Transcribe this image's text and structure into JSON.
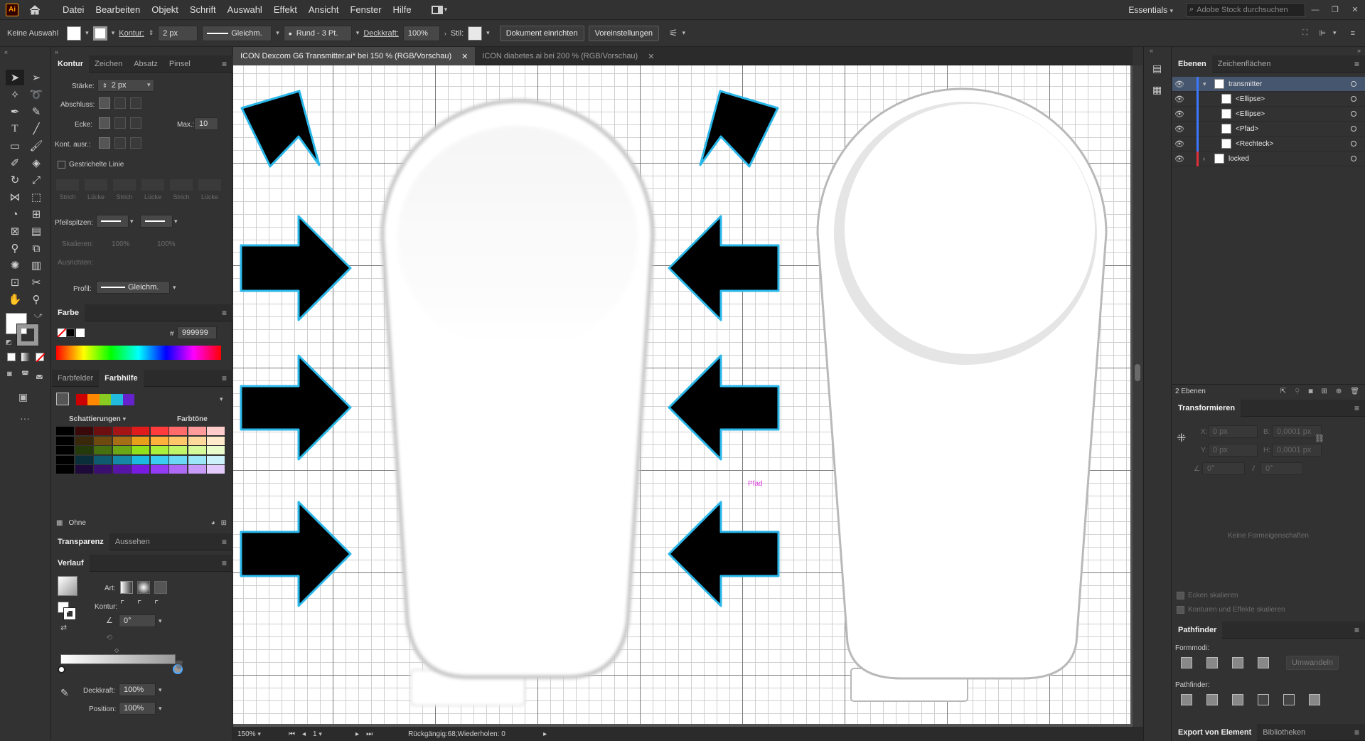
{
  "app": {
    "logo": "Ai",
    "workspace": "Essentials",
    "search_placeholder": "Adobe Stock durchsuchen"
  },
  "menu": [
    "Datei",
    "Bearbeiten",
    "Objekt",
    "Schrift",
    "Auswahl",
    "Effekt",
    "Ansicht",
    "Fenster",
    "Hilfe"
  ],
  "control": {
    "selection": "Keine Auswahl",
    "stroke_label": "Kontur:",
    "stroke_value": "2 px",
    "stroke_profile": "Gleichm.",
    "brush": "Rund - 3 Pt.",
    "opacity_label": "Deckkraft:",
    "opacity_value": "100%",
    "style_label": "Stil:",
    "doc_setup": "Dokument einrichten",
    "preferences": "Voreinstellungen"
  },
  "stroke_panel": {
    "tabs": [
      "Kontur",
      "Zeichen",
      "Absatz",
      "Pinsel"
    ],
    "weight_label": "Stärke:",
    "weight_value": "2 px",
    "cap_label": "Abschluss:",
    "corner_label": "Ecke:",
    "limit_label": "Max.:",
    "limit_value": "10",
    "align_label": "Kont. ausr.:",
    "dashed_label": "Gestrichelte Linie",
    "dash_labels": [
      "Strich",
      "Lücke",
      "Strich",
      "Lücke",
      "Strich",
      "Lücke"
    ],
    "arrowheads_label": "Pfeilspitzen:",
    "scale_label": "Skalieren:",
    "scale_values": [
      "100%",
      "100%"
    ],
    "align_arrows_label": "Ausrichten:",
    "profile_label": "Profil:",
    "profile_value": "Gleichm."
  },
  "color_panel": {
    "title": "Farbe",
    "hex_value": "999999"
  },
  "colorguide": {
    "tabs": [
      "Farbfelder",
      "Farbhilfe"
    ],
    "shades_label": "Schattierungen",
    "tints_label": "Farbtöne",
    "footer": "Ohne",
    "harmony": [
      "#cc0000",
      "#ff8800",
      "#88cc22",
      "#22bbdd",
      "#6622cc"
    ],
    "grid": [
      [
        "#000000",
        "#3a0a0a",
        "#6e0f0f",
        "#a61515",
        "#e01b1b",
        "#ff3b3b",
        "#ff6a6a",
        "#ff9b9b",
        "#ffcccc"
      ],
      [
        "#000000",
        "#3a280a",
        "#6e4a0f",
        "#a66f15",
        "#e8a01b",
        "#ffb23b",
        "#ffc66a",
        "#ffd89b",
        "#ffeacc"
      ],
      [
        "#000000",
        "#253a0a",
        "#46700f",
        "#6aa615",
        "#90e01b",
        "#a9ef3b",
        "#c0f56a",
        "#d6f99b",
        "#ebfccc"
      ],
      [
        "#000000",
        "#0a2f3a",
        "#0f5a6e",
        "#1588a6",
        "#1bb8e0",
        "#3bccf2",
        "#6ad9f5",
        "#9be6f9",
        "#ccf2fc"
      ],
      [
        "#000000",
        "#1e0a3a",
        "#3a0f6e",
        "#5715a6",
        "#781be0",
        "#933bf2",
        "#ad6af5",
        "#c89bf9",
        "#e3ccfc"
      ]
    ]
  },
  "transparency": {
    "tabs": [
      "Transparenz",
      "Aussehen"
    ]
  },
  "gradient": {
    "title": "Verlauf",
    "type_label": "Art:",
    "stroke_label": "Kontur:",
    "angle_value": "0°",
    "opacity_label": "Deckkraft:",
    "opacity_value": "100%",
    "position_label": "Position:",
    "position_value": "100%"
  },
  "doc_tabs": [
    {
      "label": "ICON Dexcom G6 Transmitter.ai* bei 150 % (RGB/Vorschau)",
      "active": true
    },
    {
      "label": "ICON diabetes.ai bei 200 % (RGB/Vorschau)",
      "active": false
    }
  ],
  "canvas": {
    "hover_label": "Pfad"
  },
  "status": {
    "zoom": "150%",
    "page": "1",
    "undo": "Rückgängig:68;Wiederholen: 0"
  },
  "layers": {
    "tabs": [
      "Ebenen",
      "Zeichenflächen"
    ],
    "rows": [
      {
        "name": "transmitter",
        "level": 0,
        "color": "#3c78ff",
        "expanded": true,
        "selected": true
      },
      {
        "name": "<Ellipse>",
        "level": 1,
        "color": "#3c78ff"
      },
      {
        "name": "<Ellipse>",
        "level": 1,
        "color": "#3c78ff"
      },
      {
        "name": "<Pfad>",
        "level": 1,
        "color": "#3c78ff"
      },
      {
        "name": "<Rechteck>",
        "level": 1,
        "color": "#3c78ff"
      },
      {
        "name": "locked",
        "level": 0,
        "color": "#e0303a",
        "expanded": false
      }
    ],
    "count": "2 Ebenen"
  },
  "transform": {
    "title": "Transformieren",
    "x_label": "X:",
    "x_value": "0 px",
    "y_label": "Y:",
    "y_value": "0 px",
    "w_label": "B:",
    "w_value": "0,0001 px",
    "h_label": "H:",
    "h_value": "0,0001 px",
    "angle_value": "0°",
    "shear_value": "0°",
    "no_shape": "Keine Formeigenschaften",
    "scale_corners": "Ecken skalieren",
    "scale_strokes": "Konturen und Effekte skalieren"
  },
  "pathfinder": {
    "title": "Pathfinder",
    "shape_modes_label": "Formmodi:",
    "expand": "Umwandeln",
    "pathfinders_label": "Pathfinder:"
  },
  "bottom_tabs": [
    "Export von Element",
    "Bibliotheken"
  ]
}
